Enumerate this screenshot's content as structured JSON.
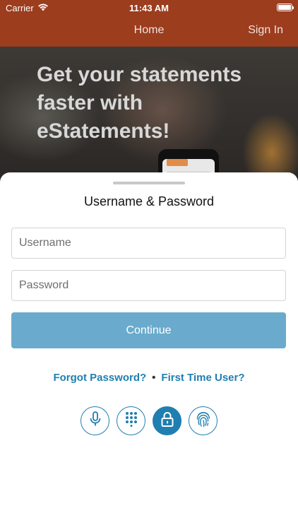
{
  "status_bar": {
    "carrier": "Carrier",
    "time": "11:43 AM"
  },
  "nav": {
    "home_label": "Home",
    "sign_in_label": "Sign In"
  },
  "hero": {
    "headline": "Get your statements faster with eStatements!"
  },
  "login": {
    "title": "Username & Password",
    "username_placeholder": "Username",
    "password_placeholder": "Password",
    "continue_label": "Continue",
    "forgot_password": "Forgot Password?",
    "separator": "•",
    "first_time_user": "First Time User?"
  },
  "auth_methods": [
    {
      "icon": "microphone-icon",
      "active": false
    },
    {
      "icon": "keypad-icon",
      "active": false
    },
    {
      "icon": "lock-icon",
      "active": true
    },
    {
      "icon": "fingerprint-icon",
      "active": false
    }
  ],
  "colors": {
    "nav_bar": "#9c3d1e",
    "accent": "#1f7fb0",
    "continue_button": "#6aabcd"
  }
}
